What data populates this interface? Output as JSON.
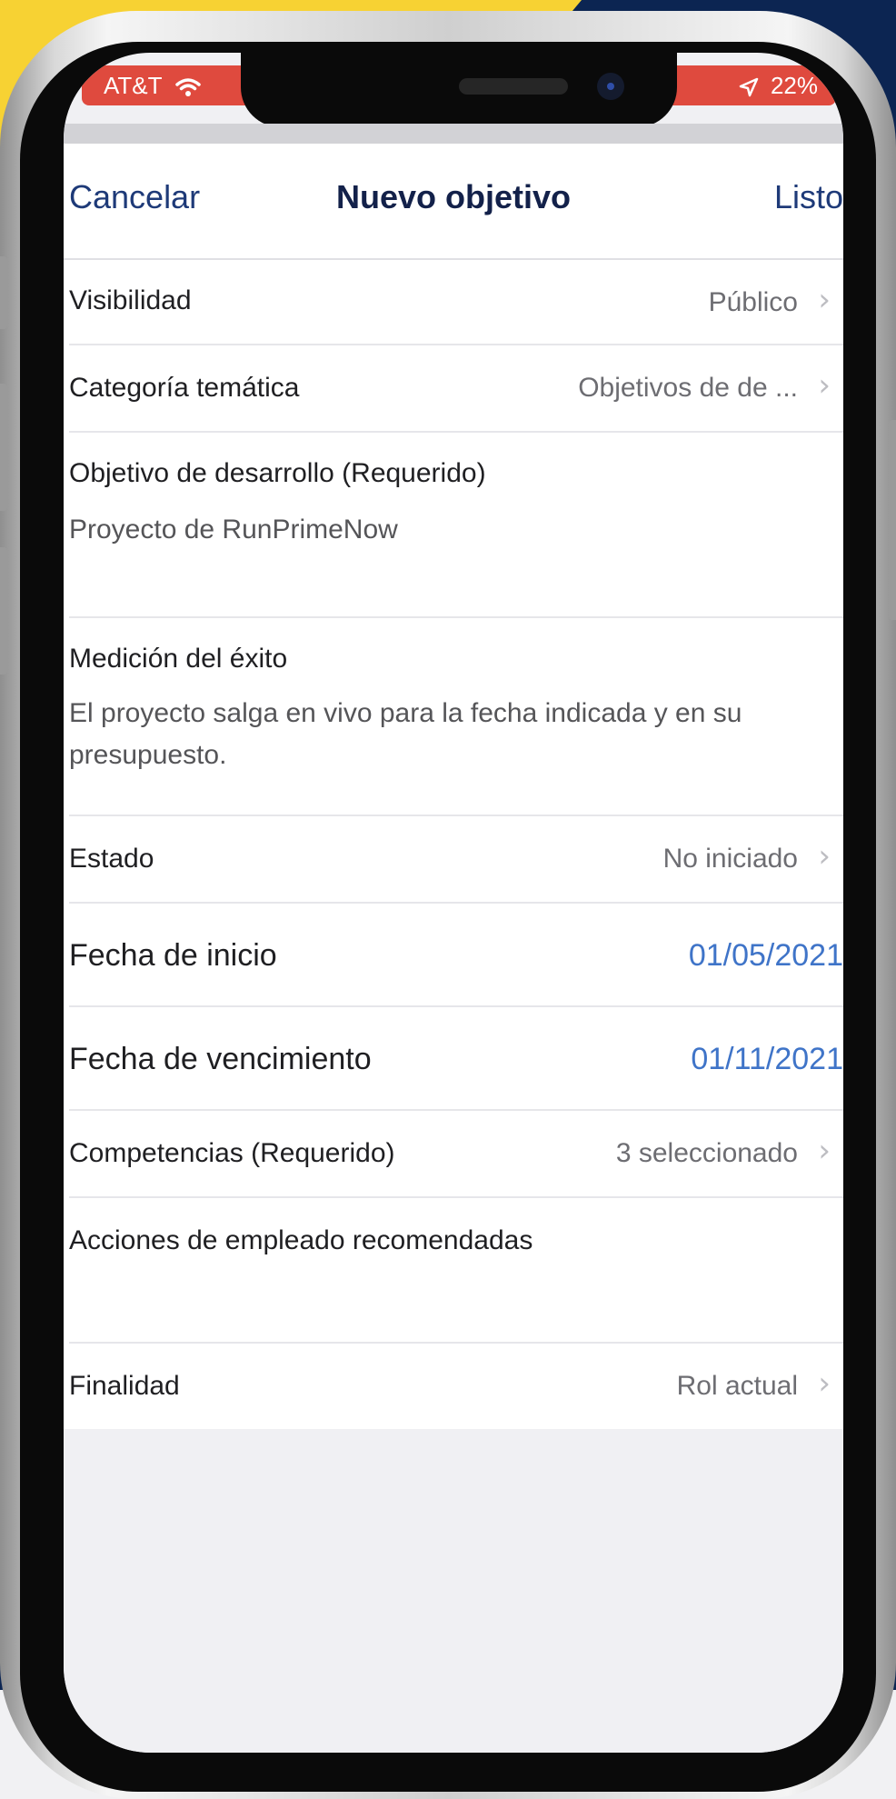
{
  "status_bar": {
    "carrier": "AT&T",
    "battery": "22%"
  },
  "nav": {
    "cancel_label": "Cancelar",
    "title": "Nuevo objetivo",
    "done_label": "Listo"
  },
  "rows": {
    "visibility": {
      "label": "Visibilidad",
      "value": "Público"
    },
    "category": {
      "label": "Categoría temática",
      "value": "Objetivos de de ..."
    },
    "goal": {
      "label": "Objetivo de desarrollo (Requerido)",
      "value": "Proyecto de RunPrimeNow"
    },
    "measure": {
      "label": "Medición del éxito",
      "value": "El proyecto salga en vivo para la fecha indicada y en su presupuesto."
    },
    "status": {
      "label": "Estado",
      "value": "No iniciado"
    },
    "start_date": {
      "label": "Fecha de inicio",
      "value": "01/05/2021"
    },
    "due_date": {
      "label": "Fecha de vencimiento",
      "value": "01/11/2021"
    },
    "competencies": {
      "label": "Competencias (Requerido)",
      "value": "3 seleccionado"
    },
    "actions": {
      "label": "Acciones de empleado recomendadas",
      "value": ""
    },
    "purpose": {
      "label": "Finalidad",
      "value": "Rol actual"
    }
  },
  "colors": {
    "accent_blue": "#3f74c8",
    "nav_text": "#1e3a78",
    "status_red": "#df4a3e",
    "bg_navy": "#0c2552",
    "bg_yellow": "#f7d233"
  },
  "icons": {
    "wifi": "wifi-icon",
    "location": "location-arrow-icon",
    "chevron": "chevron-right-icon"
  }
}
